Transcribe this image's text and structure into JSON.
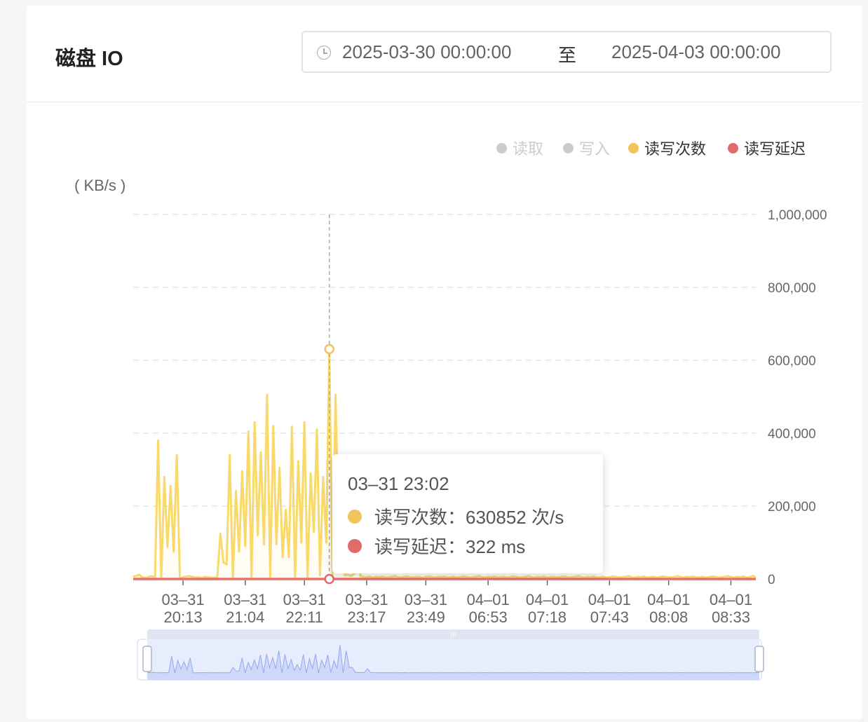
{
  "header": {
    "title": "磁盘 IO",
    "range_start": "2025-03-30 00:00:00",
    "range_sep": "至",
    "range_end": "2025-04-03 00:00:00"
  },
  "legend": [
    {
      "label": "读取",
      "color": "#cccccc",
      "active": false
    },
    {
      "label": "写入",
      "color": "#cccccc",
      "active": false
    },
    {
      "label": "读写次数",
      "color": "#f2c55c",
      "active": true
    },
    {
      "label": "读写延迟",
      "color": "#e06c6a",
      "active": true
    }
  ],
  "tooltip": {
    "time": "03–31 23:02",
    "rows": [
      {
        "label": "读写次数：630852 次/s",
        "color": "#f2c55c"
      },
      {
        "label": "读写延迟：322 ms",
        "color": "#e06c6a"
      }
    ]
  },
  "chart_data": {
    "type": "line",
    "ylabel": "( KB/s )",
    "ylim": [
      0,
      1000000
    ],
    "yticks": [
      "0",
      "200,000",
      "400,000",
      "600,000",
      "800,000",
      "1,000,000"
    ],
    "yvals": [
      0,
      200000,
      400000,
      600000,
      800000,
      1000000
    ],
    "xticks": [
      {
        "index": 16,
        "l1": "03–31",
        "l2": "20:13"
      },
      {
        "index": 36,
        "l1": "03–31",
        "l2": "21:04"
      },
      {
        "index": 55,
        "l1": "03–31",
        "l2": "22:11"
      },
      {
        "index": 75,
        "l1": "03–31",
        "l2": "23:17"
      },
      {
        "index": 94,
        "l1": "03–31",
        "l2": "23:49"
      },
      {
        "index": 114,
        "l1": "04–01",
        "l2": "06:53"
      },
      {
        "index": 133,
        "l1": "04–01",
        "l2": "07:18"
      },
      {
        "index": 153,
        "l1": "04–01",
        "l2": "07:43"
      },
      {
        "index": 172,
        "l1": "04–01",
        "l2": "08:08"
      },
      {
        "index": 192,
        "l1": "04–01",
        "l2": "08:33"
      }
    ],
    "highlight_index": 63,
    "grid": true,
    "legend_position": "top-right",
    "series": [
      {
        "name": "读写次数",
        "color": "#f8d96a",
        "values": [
          6000,
          9000,
          12000,
          4000,
          3000,
          6000,
          8000,
          4000,
          380000,
          0,
          280000,
          88000,
          255000,
          75000,
          340000,
          0,
          5000,
          7000,
          8000,
          6000,
          4000,
          5000,
          3000,
          6000,
          5000,
          4000,
          3000,
          5000,
          125000,
          45000,
          40000,
          340000,
          0,
          242000,
          75000,
          296000,
          90000,
          405000,
          0,
          430000,
          120000,
          348000,
          95000,
          505000,
          0,
          420000,
          95000,
          305000,
          60000,
          190000,
          60000,
          418000,
          0,
          323000,
          100000,
          430000,
          0,
          290000,
          130000,
          410000,
          10000,
          280000,
          100000,
          630852,
          0,
          505000,
          125000,
          125000,
          10000,
          12000,
          8000,
          15000,
          95000,
          8000,
          6000,
          5000,
          7000,
          4000,
          6000,
          5000,
          7000,
          4000,
          5000,
          6000,
          8000,
          5000,
          4000,
          6000,
          7000,
          5000,
          4000,
          6000,
          5000,
          3000,
          6000,
          7000,
          5000,
          4000,
          6000,
          5000,
          7000,
          4000,
          5000,
          6000,
          4000,
          5000,
          7000,
          6000,
          4000,
          5000,
          6000,
          8000,
          5000,
          4000,
          6000,
          5000,
          7000,
          4000,
          5000,
          6000,
          4000,
          5000,
          7000,
          6000,
          4000,
          5000,
          6000,
          8000,
          5000,
          4000,
          6000,
          5000,
          7000,
          4000,
          5000,
          6000,
          4000,
          5000,
          7000,
          6000,
          4000,
          5000,
          6000,
          8000,
          5000,
          4000,
          6000,
          5000,
          7000,
          4000,
          5000,
          6000,
          4000,
          5000,
          7000,
          6000,
          4000,
          5000,
          6000,
          8000,
          5000,
          4000,
          6000,
          5000,
          7000,
          4000,
          5000,
          6000,
          4000,
          5000,
          7000,
          6000,
          4000,
          5000,
          6000,
          8000,
          5000,
          4000,
          6000,
          5000,
          7000,
          4000,
          5000,
          6000,
          4000,
          5000,
          7000,
          6000,
          4000,
          5000,
          6000,
          8000,
          5000,
          4000,
          6000,
          5000,
          7000,
          4000,
          5000,
          9000,
          4000
        ]
      },
      {
        "name": "读写延迟",
        "color": "#e8706b",
        "value_at_highlight": 322
      }
    ]
  },
  "datazoom": {
    "start_percent": 0,
    "end_percent": 100
  }
}
